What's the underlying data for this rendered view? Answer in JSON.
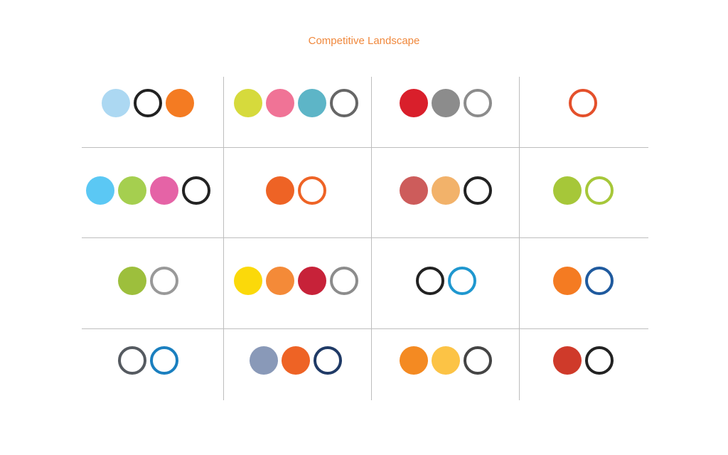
{
  "title": "Competitive Landscape",
  "colors": {
    "title": "#f0883c",
    "grid": "#bdbdbd"
  },
  "palettes": [
    {
      "row": 0,
      "col": 0,
      "swatches": [
        {
          "color": "#acd8f2",
          "fill": true
        },
        {
          "color": "#222222",
          "fill": false
        },
        {
          "color": "#f47b22",
          "fill": true
        }
      ]
    },
    {
      "row": 0,
      "col": 1,
      "swatches": [
        {
          "color": "#d6da3c",
          "fill": true
        },
        {
          "color": "#f07396",
          "fill": true
        },
        {
          "color": "#5db5c7",
          "fill": true
        },
        {
          "color": "#666666",
          "fill": false
        }
      ]
    },
    {
      "row": 0,
      "col": 2,
      "swatches": [
        {
          "color": "#d91f2b",
          "fill": true
        },
        {
          "color": "#8c8c8c",
          "fill": true
        },
        {
          "color": "#8c8c8c",
          "fill": false
        }
      ]
    },
    {
      "row": 0,
      "col": 3,
      "swatches": [
        {
          "color": "#e4502b",
          "fill": false
        }
      ]
    },
    {
      "row": 1,
      "col": 0,
      "swatches": [
        {
          "color": "#5bc8f4",
          "fill": true
        },
        {
          "color": "#a5cf4f",
          "fill": true
        },
        {
          "color": "#e563a6",
          "fill": true
        },
        {
          "color": "#222222",
          "fill": false
        }
      ]
    },
    {
      "row": 1,
      "col": 1,
      "swatches": [
        {
          "color": "#ee6325",
          "fill": true
        },
        {
          "color": "#ee6325",
          "fill": false
        }
      ]
    },
    {
      "row": 1,
      "col": 2,
      "swatches": [
        {
          "color": "#cd5c5b",
          "fill": true
        },
        {
          "color": "#f2b26a",
          "fill": true
        },
        {
          "color": "#222222",
          "fill": false
        }
      ]
    },
    {
      "row": 1,
      "col": 3,
      "swatches": [
        {
          "color": "#a6c739",
          "fill": true
        },
        {
          "color": "#a6c739",
          "fill": false
        }
      ]
    },
    {
      "row": 2,
      "col": 0,
      "swatches": [
        {
          "color": "#9dbf3c",
          "fill": true
        },
        {
          "color": "#999999",
          "fill": false
        }
      ]
    },
    {
      "row": 2,
      "col": 1,
      "swatches": [
        {
          "color": "#fbd90a",
          "fill": true
        },
        {
          "color": "#f48a38",
          "fill": true
        },
        {
          "color": "#c72239",
          "fill": true
        },
        {
          "color": "#8c8c8c",
          "fill": false
        }
      ]
    },
    {
      "row": 2,
      "col": 2,
      "swatches": [
        {
          "color": "#222222",
          "fill": false
        },
        {
          "color": "#1f97cf",
          "fill": false
        }
      ]
    },
    {
      "row": 2,
      "col": 3,
      "swatches": [
        {
          "color": "#f47b22",
          "fill": true
        },
        {
          "color": "#1f5a9e",
          "fill": false
        }
      ]
    },
    {
      "row": 3,
      "col": 0,
      "swatches": [
        {
          "color": "#555a60",
          "fill": false
        },
        {
          "color": "#1a7fbf",
          "fill": false
        }
      ]
    },
    {
      "row": 3,
      "col": 1,
      "swatches": [
        {
          "color": "#8999b8",
          "fill": true
        },
        {
          "color": "#ee6325",
          "fill": true
        },
        {
          "color": "#1f3a66",
          "fill": false
        }
      ]
    },
    {
      "row": 3,
      "col": 2,
      "swatches": [
        {
          "color": "#f48a22",
          "fill": true
        },
        {
          "color": "#fcc345",
          "fill": true
        },
        {
          "color": "#444444",
          "fill": false
        }
      ]
    },
    {
      "row": 3,
      "col": 3,
      "swatches": [
        {
          "color": "#cf3a2a",
          "fill": true
        },
        {
          "color": "#222222",
          "fill": false
        }
      ]
    }
  ]
}
